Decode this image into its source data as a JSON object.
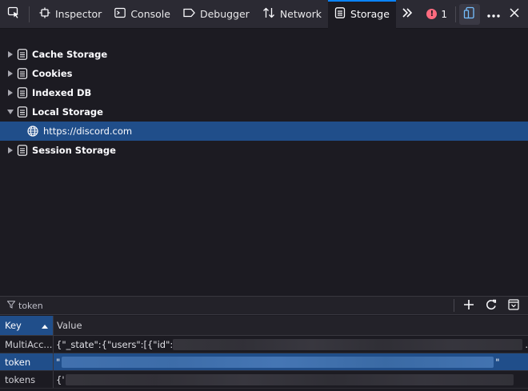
{
  "toolbar": {
    "tabs": [
      {
        "label": "Inspector",
        "icon": "inspector-icon"
      },
      {
        "label": "Console",
        "icon": "console-icon"
      },
      {
        "label": "Debugger",
        "icon": "debugger-icon"
      },
      {
        "label": "Network",
        "icon": "network-icon"
      },
      {
        "label": "Storage",
        "icon": "storage-icon",
        "selected": true
      }
    ],
    "error_count": "1",
    "accent": "#0a84ff"
  },
  "tree": {
    "items": [
      {
        "label": "Cache Storage",
        "expanded": false
      },
      {
        "label": "Cookies",
        "expanded": false
      },
      {
        "label": "Indexed DB",
        "expanded": false
      },
      {
        "label": "Local Storage",
        "expanded": true
      },
      {
        "label": "https://discord.com",
        "child": true,
        "selected": true
      },
      {
        "label": "Session Storage",
        "expanded": false
      }
    ]
  },
  "filter": {
    "value": "token"
  },
  "table": {
    "headers": {
      "key": "Key",
      "value": "Value"
    },
    "rows": [
      {
        "key": "MultiAcc...",
        "value_prefix": "{\"_state\":{\"users\":[{\"id\":",
        "value_suffix": "."
      },
      {
        "key": "token",
        "value_prefix": "\"",
        "value_suffix": "\"",
        "selected": true
      },
      {
        "key": "tokens",
        "value_prefix": "{'",
        "value_suffix": ""
      }
    ]
  },
  "colors": {
    "selection": "#204e8a",
    "background": "#1c1b22",
    "toolbar": "#2b2a33",
    "error": "#ff6b7f"
  }
}
